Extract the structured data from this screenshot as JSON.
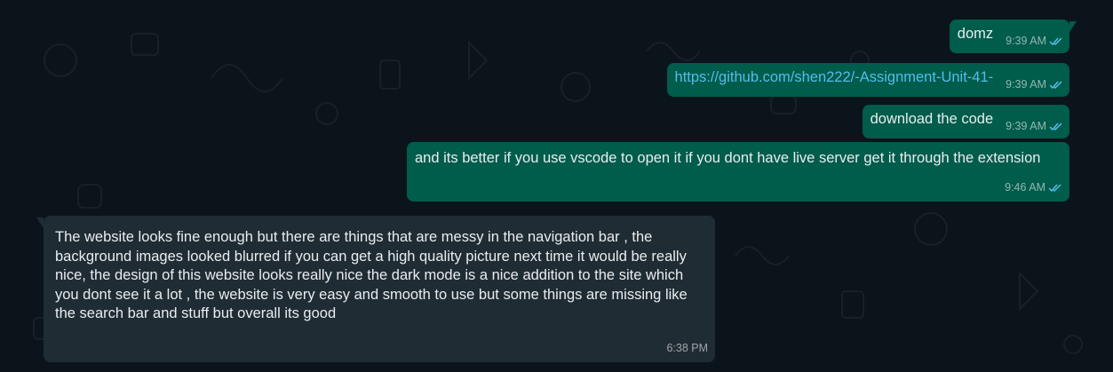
{
  "colors": {
    "background": "#0b141a",
    "outgoing_bubble": "#005c4b",
    "incoming_bubble": "#202c33",
    "link": "#53bdeb",
    "read_ticks": "#53bdeb"
  },
  "messages": [
    {
      "direction": "outgoing",
      "text": "domz",
      "time": "9:39 AM",
      "status": "read"
    },
    {
      "direction": "outgoing",
      "text": "https://github.com/shen222/-Assignment-Unit-41-",
      "is_link": true,
      "time": "9:39 AM",
      "status": "read"
    },
    {
      "direction": "outgoing",
      "text": "download the code",
      "time": "9:39 AM",
      "status": "read"
    },
    {
      "direction": "outgoing",
      "text": "and its better if you use vscode to open it if you dont have live server get it through the extension",
      "time": "9:46 AM",
      "status": "read"
    },
    {
      "direction": "incoming",
      "text": "The website looks fine enough but there are things that are messy in the navigation bar , the background images looked blurred if you can get a high quality picture next time it would be really nice, the design of this website looks really nice the dark mode is a nice addition to the site which you dont see it a lot , the website is very easy and smooth to use but some things are missing like the search bar and stuff but overall its good",
      "time": "6:38 PM"
    }
  ]
}
